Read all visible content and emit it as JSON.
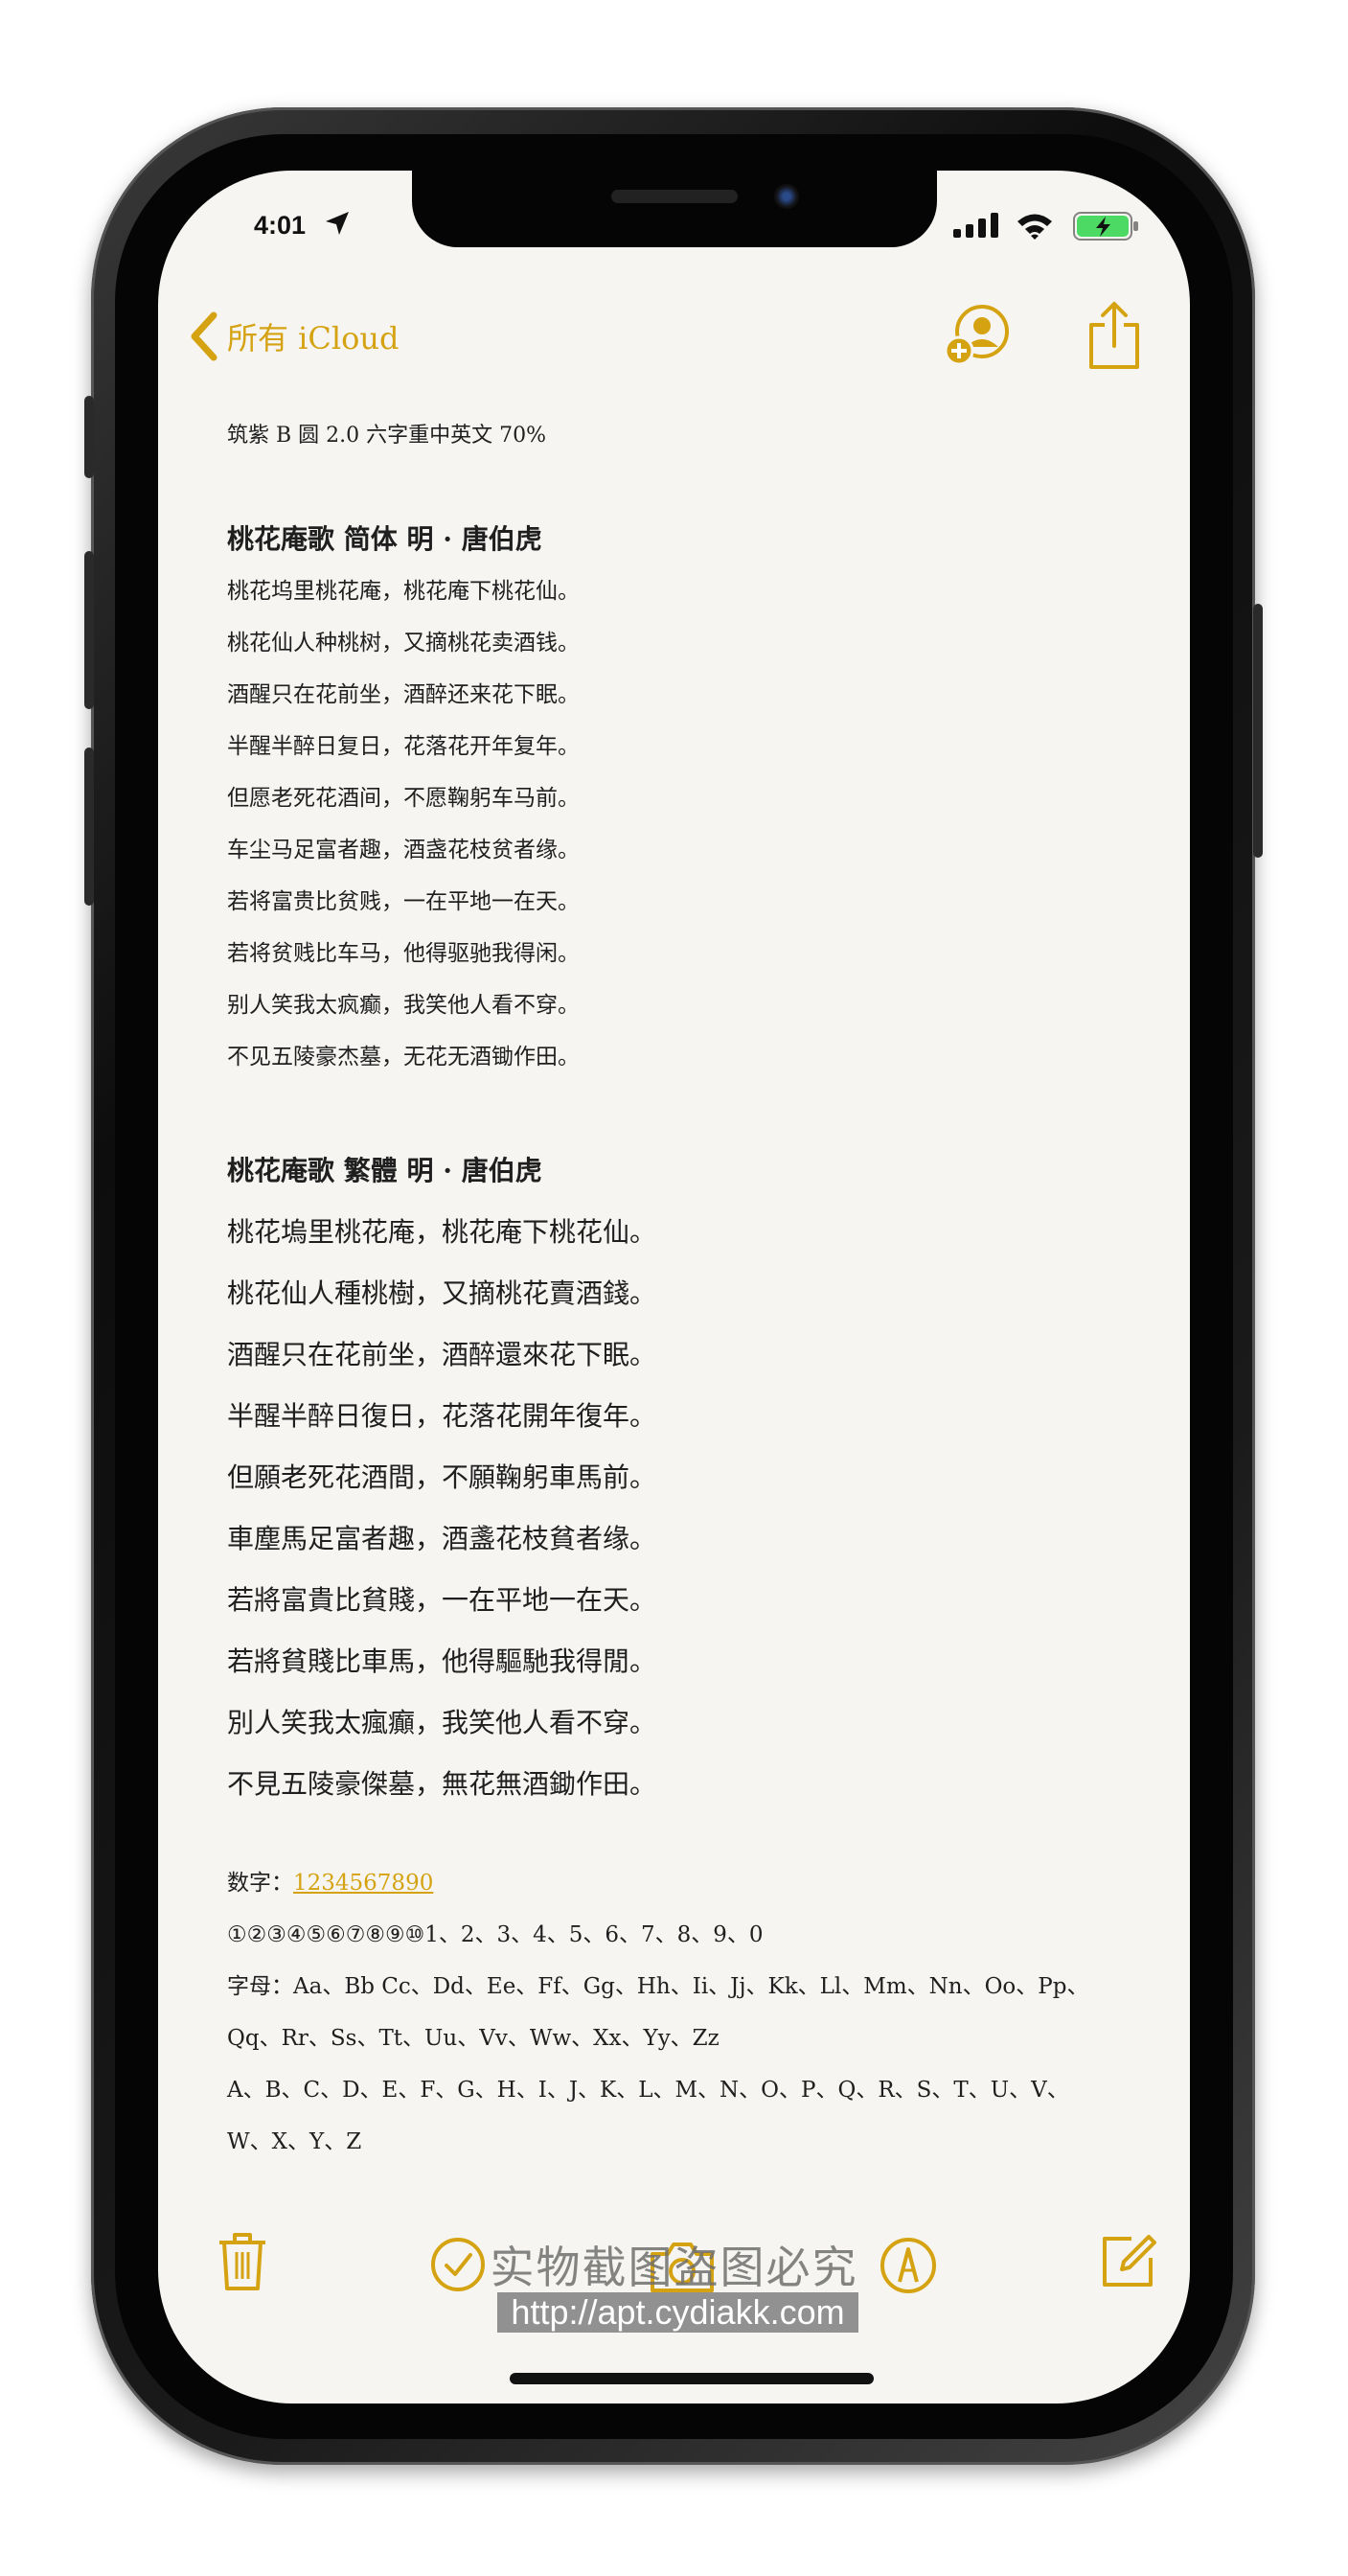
{
  "status_bar": {
    "time": "4:01"
  },
  "nav": {
    "back_label": "所有 iCloud"
  },
  "note": {
    "font_line": "筑紫 B 圆 2.0 六字重中英文 70%",
    "simplified_title": "桃花庵歌  简体   明 · 唐伯虎",
    "simplified_lines": [
      "桃花坞里桃花庵，桃花庵下桃花仙。",
      "桃花仙人种桃树，又摘桃花卖酒钱。",
      "酒醒只在花前坐，酒醉还来花下眠。",
      "半醒半醉日复日，花落花开年复年。",
      "但愿老死花酒间，不愿鞠躬车马前。",
      "车尘马足富者趣，酒盏花枝贫者缘。",
      "若将富贵比贫贱，一在平地一在天。",
      "若将贫贱比车马，他得驱驰我得闲。",
      "别人笑我太疯癫，我笑他人看不穿。",
      "不见五陵豪杰墓，无花无酒锄作田。"
    ],
    "traditional_title": "桃花庵歌  繁體      明 · 唐伯虎",
    "traditional_lines": [
      "桃花塢里桃花庵，桃花庵下桃花仙。",
      "桃花仙人種桃樹，又摘桃花賣酒錢。",
      "酒醒只在花前坐，酒醉還來花下眠。",
      "半醒半醉日復日，花落花開年復年。",
      "但願老死花酒間，不願鞠躬車馬前。",
      "車塵馬足富者趣，酒盞花枝貧者缘。",
      "若將富貴比貧賤，一在平地一在天。",
      "若將貧賤比車馬，他得驅馳我得閒。",
      "別人笑我太瘋癲，我笑他人看不穿。",
      "不見五陵豪傑墓，無花無酒鋤作田。"
    ],
    "digits_label": "数字：",
    "digits_value": "1234567890",
    "circled_line": "①②③④⑤⑥⑦⑧⑨⑩1、2、3、4、5、6、7、8、9、0",
    "letters_line1": "字母：Aa、Bb Cc、Dd、Ee、Ff、Gg、Hh、Ii、Jj、Kk、Ll、Mm、Nn、Oo、Pp、",
    "letters_line2": "Qq、Rr、Ss、Tt、Uu、Vv、Ww、Xx、Yy、Zz",
    "upper_line1": "A、B、C、D、E、F、G、H、I、J、K、L、M、N、O、P、Q、R、S、T、U、V、",
    "upper_line2": "W、X、Y、Z"
  },
  "watermark": {
    "cn": "实物截图盗图必究",
    "url": "http://apt.cydiakk.com"
  },
  "colors": {
    "accent": "#d5a312",
    "paper": "#f6f5f2"
  },
  "icons": [
    "location-arrow-icon",
    "cellular-signal-icon",
    "wifi-icon",
    "battery-charging-icon",
    "chevron-left-icon",
    "add-person-icon",
    "share-icon",
    "trash-icon",
    "checklist-icon",
    "camera-icon",
    "markup-pen-icon",
    "compose-icon"
  ]
}
